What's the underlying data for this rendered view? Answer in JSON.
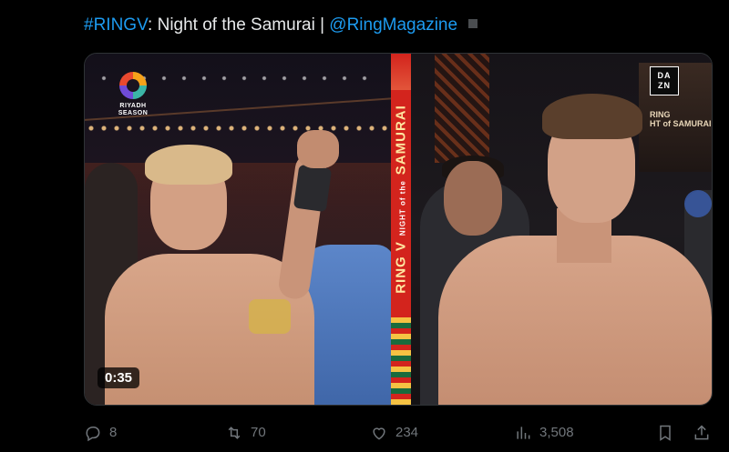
{
  "post": {
    "hashtag": "#RINGV",
    "title_middle": ": Night of the Samurai | ",
    "mention": "@RingMagazine"
  },
  "media": {
    "duration": "0:35",
    "logo_line1": "RIYADH",
    "logo_line2": "SEASON",
    "banner_main": "RING V",
    "banner_sub": "NIGHT of the",
    "banner_tail": "SAMURAI",
    "dazn_line1": "DA",
    "dazn_line2": "ZN",
    "poster_line1": "RING",
    "poster_line2": "HT of SAMURAI"
  },
  "actions": {
    "replies": "8",
    "reposts": "70",
    "likes": "234",
    "views": "3,508"
  },
  "colors": {
    "link": "#1d9bf0",
    "muted": "#71767b",
    "text": "#e7e9ea",
    "background": "#000000"
  },
  "icons": [
    "reply-icon",
    "repost-icon",
    "like-icon",
    "views-icon",
    "bookmark-icon",
    "share-icon"
  ]
}
